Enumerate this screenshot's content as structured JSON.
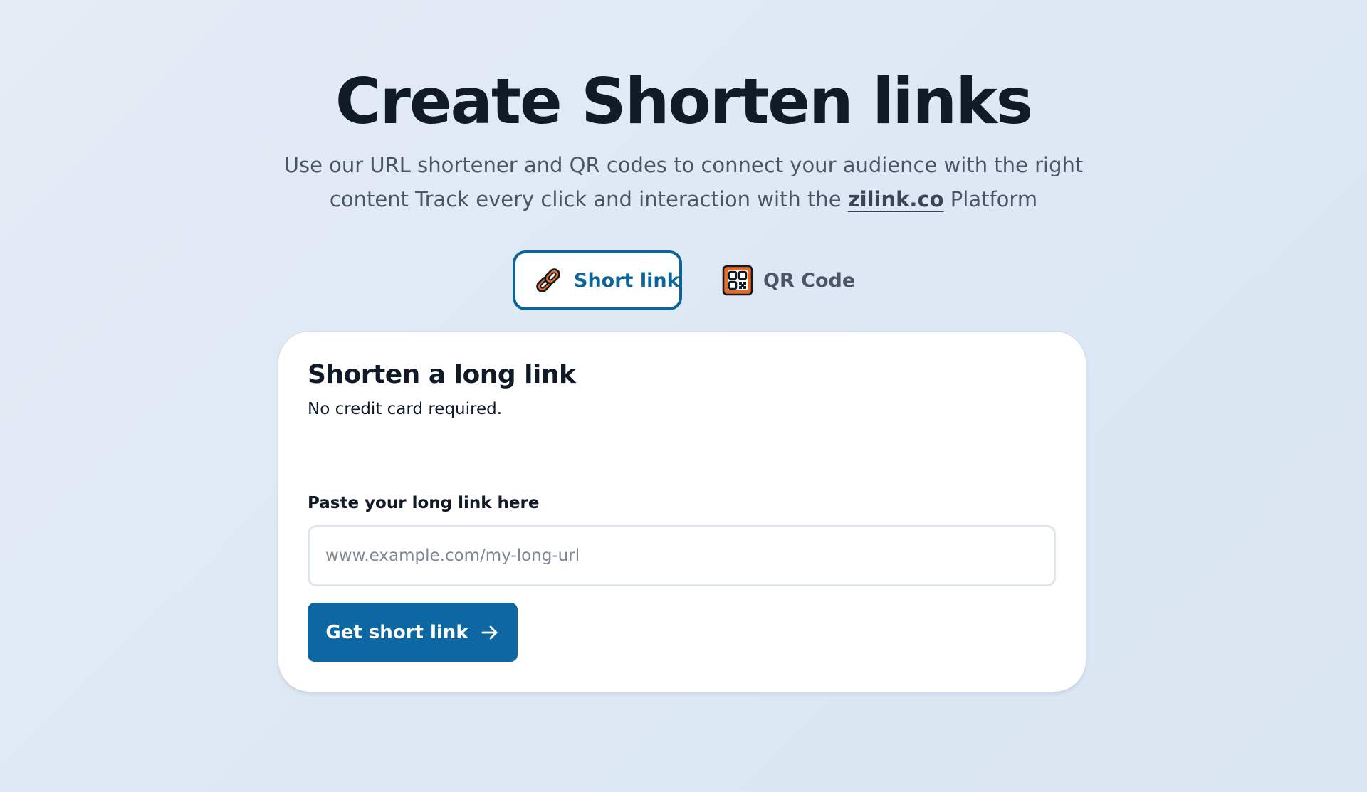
{
  "hero": {
    "title": "Create Shorten links",
    "subtitle_before": "Use our URL shortener and QR codes to connect your audience with the right content Track every click and interaction with the ",
    "subtitle_brand": "zilink.co",
    "subtitle_after": " Platform"
  },
  "tabs": [
    {
      "label": "Short link",
      "icon": "chain-link-icon",
      "active": true
    },
    {
      "label": "QR Code",
      "icon": "qr-code-icon",
      "active": false
    }
  ],
  "card": {
    "title": "Shorten a long link",
    "subtitle": "No credit card required.",
    "field_label": "Paste your long link here",
    "input_placeholder": "www.example.com/my-long-url",
    "input_value": "",
    "button_label": "Get short link",
    "button_icon": "arrow-right-icon"
  },
  "colors": {
    "accent": "#0d6498",
    "button": "#0d67a3",
    "icon_orange": "#e96a26",
    "background": "#e0eaf5"
  }
}
